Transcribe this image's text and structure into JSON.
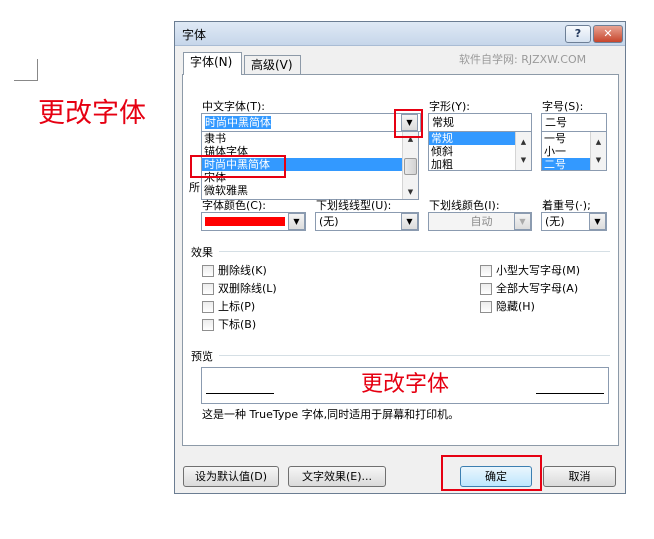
{
  "annotation": {
    "text": "更改字体"
  },
  "dialog": {
    "title": "字体",
    "help_label": "?",
    "close_label": "✕",
    "watermark": "软件自学网: RJZXW.COM",
    "tabs": [
      {
        "label": "字体(N)",
        "active": true
      },
      {
        "label": "高级(V)",
        "active": false
      }
    ]
  },
  "font": {
    "chinese_font_label": "中文字体(T):",
    "chinese_font_value": "时尚中黑简体",
    "chinese_font_list": [
      "隶书",
      "锚体字体",
      "时尚中黑简体",
      "宋体",
      "微软雅黑"
    ],
    "chinese_font_selected": 2,
    "style_label": "字形(Y):",
    "style_value": "常规",
    "style_list": [
      "常规",
      "倾斜",
      "加粗"
    ],
    "style_selected": 0,
    "size_label": "字号(S):",
    "size_value": "二号",
    "size_list": [
      "一号",
      "小一",
      "二号"
    ],
    "size_selected": 2,
    "western_font_label": "所",
    "font_color_label": "字体颜色(C):",
    "font_color_value": "#ff0000",
    "underline_style_label": "下划线线型(U):",
    "underline_style_value": "(无)",
    "underline_color_label": "下划线颜色(I):",
    "underline_color_value": "自动",
    "emphasis_label": "着重号(·);",
    "emphasis_value": "(无)"
  },
  "effects": {
    "title": "效果",
    "left": [
      "删除线(K)",
      "双删除线(L)",
      "上标(P)",
      "下标(B)"
    ],
    "right": [
      "小型大写字母(M)",
      "全部大写字母(A)",
      "隐藏(H)"
    ]
  },
  "preview": {
    "title": "预览",
    "sample_text": "更改字体",
    "note": "这是一种 TrueType 字体,同时适用于屏幕和打印机。"
  },
  "buttons": {
    "set_default": "设为默认值(D)",
    "text_effects": "文字效果(E)...",
    "ok": "确定",
    "cancel": "取消"
  },
  "colors": {
    "highlight": "#e60012",
    "selection": "#3399ff",
    "font_color": "#ff0000"
  }
}
